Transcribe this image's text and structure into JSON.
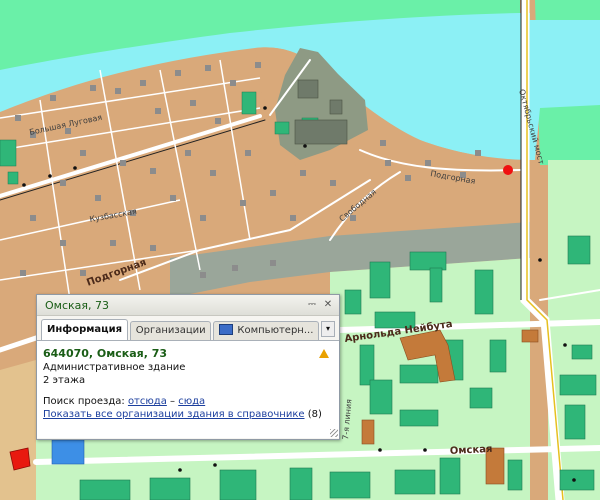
{
  "map": {
    "streets": [
      {
        "name": "Большая Луговая"
      },
      {
        "name": "Кузбасская"
      },
      {
        "name": "Подгорная"
      },
      {
        "name": "Подгорная"
      },
      {
        "name": "Свободная"
      },
      {
        "name": "Октябрьский мост"
      },
      {
        "name": "Арнольда Нейбута"
      },
      {
        "name": "7-я линия"
      },
      {
        "name": "Омская"
      }
    ],
    "colors": {
      "land": "#d9a97a",
      "water": "#8cf0f5",
      "park": "#6af0a8",
      "residential": "#c6f5c2",
      "industrial": "#8e9a84",
      "road": "#ffffff",
      "building_green": "#2fb678",
      "building_brown": "#c47a3a",
      "building_blue": "#3d8fe6",
      "highlight_red": "#e8190f"
    }
  },
  "popup": {
    "title": "Омская, 73",
    "tabs": [
      {
        "label": "Информация"
      },
      {
        "label": "Организации"
      },
      {
        "label": "Компьютерн..."
      }
    ],
    "address": "644070, Омская, 73",
    "building_type": "Административное здание",
    "floors": "2 этажа",
    "route_label": "Поиск проезда:",
    "route_from": "отсюда",
    "route_dash": "–",
    "route_to": "сюда",
    "orgs_link": "Показать все организации здания в справочнике",
    "orgs_count": "(8)"
  }
}
